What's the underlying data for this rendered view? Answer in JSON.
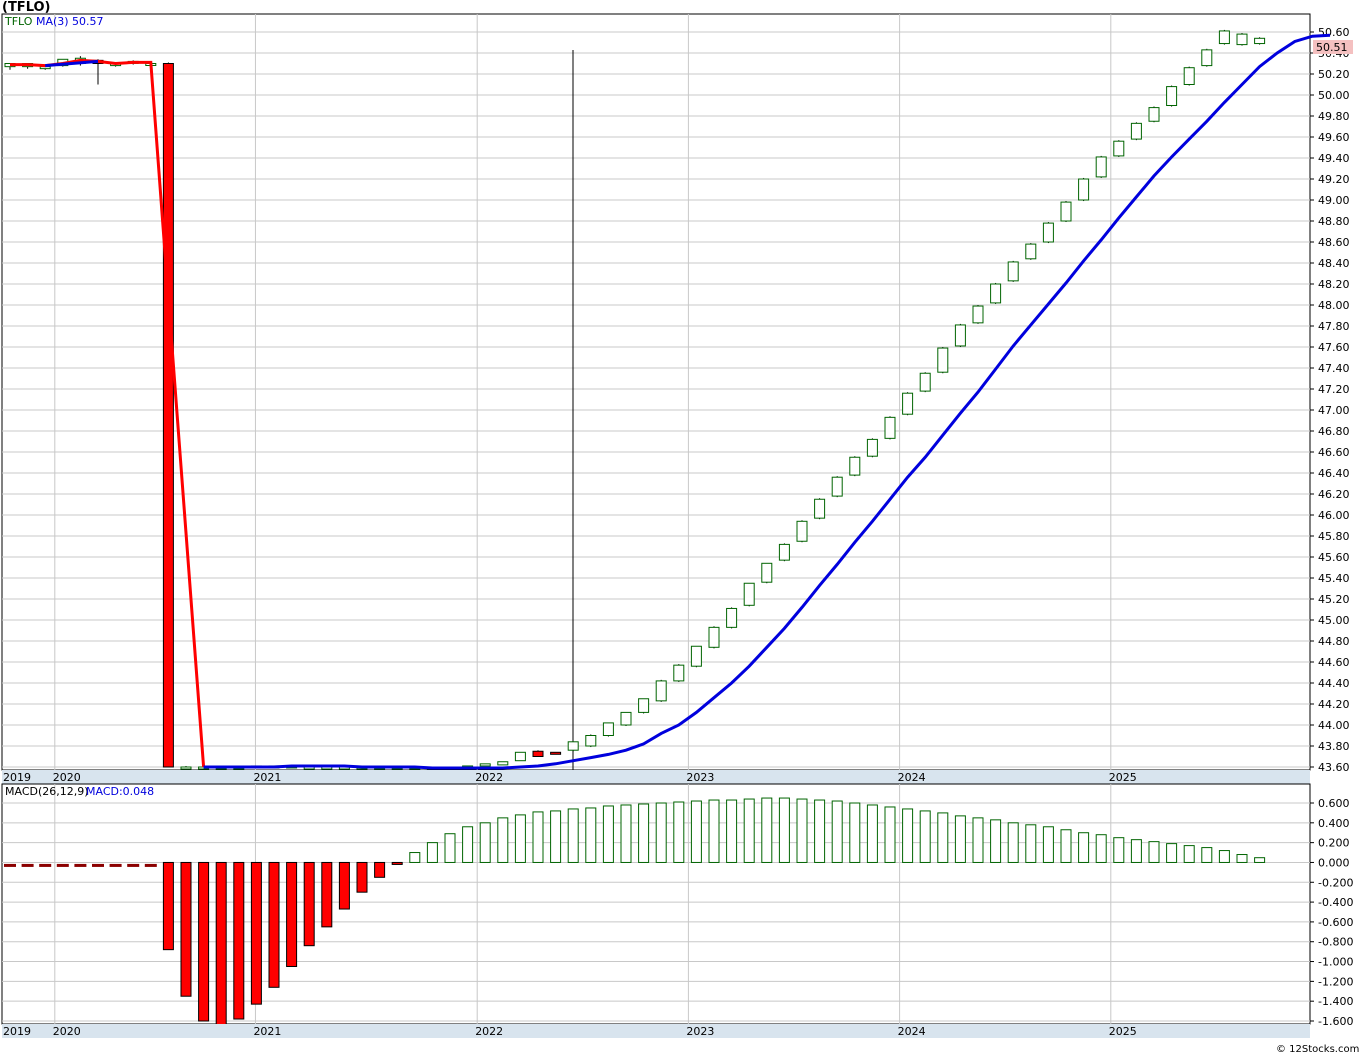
{
  "chart_title": "(TFLO)",
  "credit": "© 12Stocks.com",
  "colors": {
    "up_candle": "#006400",
    "down_candle": "#ff0000",
    "ma_line": "#0000dd",
    "pre_ma_line": "#ff0000",
    "macd_pos": "#006400",
    "macd_neg": "#ff0000",
    "macd_neg_dash": "#8b0000",
    "grid": "#c8c8c8",
    "axis_band": "#d8e4ee",
    "last_price_bg": "#f4c0c0"
  },
  "price_panel": {
    "legend": {
      "symbol": "TFLO",
      "ma_label": "MA(3)",
      "ma_value": "50.57"
    },
    "last_price": "50.51",
    "y_ticks": [
      "50.60",
      "50.40",
      "50.20",
      "50.00",
      "49.80",
      "49.60",
      "49.40",
      "49.20",
      "49.00",
      "48.80",
      "48.60",
      "48.40",
      "48.20",
      "48.00",
      "47.80",
      "47.60",
      "47.40",
      "47.20",
      "47.00",
      "46.80",
      "46.60",
      "46.40",
      "46.20",
      "46.00",
      "45.80",
      "45.60",
      "45.40",
      "45.20",
      "45.00",
      "44.80",
      "44.60",
      "44.40",
      "44.20",
      "44.00",
      "43.80",
      "43.60"
    ],
    "x_ticks": [
      "2019",
      "2020",
      "2021",
      "2022",
      "2023",
      "2024",
      "2025"
    ]
  },
  "macd_panel": {
    "legend": {
      "label": "MACD(26,12,9)",
      "value_label": "MACD:0.048"
    },
    "y_ticks": [
      "0.600",
      "0.400",
      "0.200",
      "0.000",
      "-0.200",
      "-0.400",
      "-0.600",
      "-0.800",
      "-1.000",
      "-1.200",
      "-1.400",
      "-1.600"
    ],
    "x_ticks": [
      "2019",
      "2020",
      "2021",
      "2022",
      "2023",
      "2024",
      "2025"
    ]
  },
  "chart_data": [
    {
      "type": "candlestick",
      "title": "(TFLO)",
      "ylim": [
        43.6,
        50.6
      ],
      "series": [
        {
          "name": "TFLO",
          "candles": [
            {
              "open": 50.27,
              "high": 50.3,
              "low": 50.24,
              "close": 50.3
            },
            {
              "open": 50.27,
              "high": 50.3,
              "low": 50.25,
              "close": 50.3
            },
            {
              "open": 50.26,
              "high": 50.29,
              "low": 50.24,
              "close": 50.27
            },
            {
              "open": 50.28,
              "high": 50.34,
              "low": 50.27,
              "close": 50.34
            },
            {
              "open": 50.3,
              "high": 50.37,
              "low": 50.28,
              "close": 50.35
            },
            {
              "open": 50.33,
              "high": 50.34,
              "low": 50.1,
              "close": 50.3
            },
            {
              "open": 50.28,
              "high": 50.31,
              "low": 50.27,
              "close": 50.3
            },
            {
              "open": 50.31,
              "high": 50.33,
              "low": 50.29,
              "close": 50.32
            },
            {
              "open": 50.3,
              "high": 50.32,
              "low": 50.28,
              "close": 50.3
            },
            {
              "open": 50.3,
              "high": 50.31,
              "low": 43.6,
              "close": 43.6
            },
            {
              "open": 43.6,
              "high": 43.61,
              "low": 43.59,
              "close": 43.6
            },
            {
              "open": 43.6,
              "high": 43.6,
              "low": 43.59,
              "close": 43.6
            },
            {
              "open": 43.6,
              "high": 43.6,
              "low": 43.59,
              "close": 43.6
            },
            {
              "open": 43.6,
              "high": 43.61,
              "low": 43.59,
              "close": 43.6
            },
            {
              "open": 43.6,
              "high": 43.61,
              "low": 43.6,
              "close": 43.61
            },
            {
              "open": 43.6,
              "high": 43.61,
              "low": 43.6,
              "close": 43.61
            },
            {
              "open": 43.61,
              "high": 43.62,
              "low": 43.6,
              "close": 43.61
            },
            {
              "open": 43.6,
              "high": 43.61,
              "low": 43.59,
              "close": 43.6
            },
            {
              "open": 43.6,
              "high": 43.6,
              "low": 43.59,
              "close": 43.6
            },
            {
              "open": 43.6,
              "high": 43.6,
              "low": 43.59,
              "close": 43.6
            },
            {
              "open": 43.6,
              "high": 43.61,
              "low": 43.59,
              "close": 43.6
            },
            {
              "open": 43.59,
              "high": 43.6,
              "low": 43.59,
              "close": 43.6
            },
            {
              "open": 43.59,
              "high": 43.6,
              "low": 43.59,
              "close": 43.6
            },
            {
              "open": 43.59,
              "high": 43.6,
              "low": 43.59,
              "close": 43.6
            },
            {
              "open": 43.59,
              "high": 43.6,
              "low": 43.59,
              "close": 43.6
            },
            {
              "open": 43.59,
              "high": 43.6,
              "low": 43.59,
              "close": 43.6
            },
            {
              "open": 43.6,
              "high": 43.61,
              "low": 43.6,
              "close": 43.61
            },
            {
              "open": 43.61,
              "high": 43.63,
              "low": 43.61,
              "close": 43.63
            },
            {
              "open": 43.62,
              "high": 43.65,
              "low": 43.62,
              "close": 43.65
            },
            {
              "open": 43.66,
              "high": 43.74,
              "low": 43.66,
              "close": 43.74
            },
            {
              "open": 43.75,
              "high": 43.76,
              "low": 43.7,
              "close": 43.7
            },
            {
              "open": 43.74,
              "high": 43.74,
              "low": 43.72,
              "close": 43.73
            },
            {
              "open": 43.76,
              "high": 43.84,
              "low": 43.75,
              "close": 43.84
            },
            {
              "open": 43.8,
              "high": 43.91,
              "low": 43.79,
              "close": 43.9
            },
            {
              "open": 43.9,
              "high": 44.02,
              "low": 43.89,
              "close": 44.02
            },
            {
              "open": 44.0,
              "high": 44.12,
              "low": 43.99,
              "close": 44.12
            },
            {
              "open": 44.12,
              "high": 44.25,
              "low": 44.11,
              "close": 44.25
            },
            {
              "open": 44.23,
              "high": 44.43,
              "low": 44.22,
              "close": 44.42
            },
            {
              "open": 44.42,
              "high": 44.58,
              "low": 44.41,
              "close": 44.57
            },
            {
              "open": 44.56,
              "high": 44.75,
              "low": 44.55,
              "close": 44.75
            },
            {
              "open": 44.74,
              "high": 44.94,
              "low": 44.73,
              "close": 44.93
            },
            {
              "open": 44.93,
              "high": 45.12,
              "low": 44.92,
              "close": 45.11
            },
            {
              "open": 45.14,
              "high": 45.35,
              "low": 45.13,
              "close": 45.35
            },
            {
              "open": 45.36,
              "high": 45.54,
              "low": 45.35,
              "close": 45.54
            },
            {
              "open": 45.57,
              "high": 45.73,
              "low": 45.56,
              "close": 45.72
            },
            {
              "open": 45.75,
              "high": 45.95,
              "low": 45.74,
              "close": 45.94
            },
            {
              "open": 45.97,
              "high": 46.16,
              "low": 45.96,
              "close": 46.15
            },
            {
              "open": 46.18,
              "high": 46.37,
              "low": 46.17,
              "close": 46.36
            },
            {
              "open": 46.38,
              "high": 46.56,
              "low": 46.37,
              "close": 46.55
            },
            {
              "open": 46.56,
              "high": 46.73,
              "low": 46.55,
              "close": 46.72
            },
            {
              "open": 46.73,
              "high": 46.94,
              "low": 46.72,
              "close": 46.93
            },
            {
              "open": 46.96,
              "high": 47.17,
              "low": 46.95,
              "close": 47.16
            },
            {
              "open": 47.18,
              "high": 47.36,
              "low": 47.17,
              "close": 47.35
            },
            {
              "open": 47.36,
              "high": 47.6,
              "low": 47.35,
              "close": 47.59
            },
            {
              "open": 47.61,
              "high": 47.82,
              "low": 47.6,
              "close": 47.81
            },
            {
              "open": 47.83,
              "high": 48.0,
              "low": 47.82,
              "close": 47.99
            },
            {
              "open": 48.02,
              "high": 48.21,
              "low": 48.01,
              "close": 48.2
            },
            {
              "open": 48.23,
              "high": 48.42,
              "low": 48.22,
              "close": 48.41
            },
            {
              "open": 48.44,
              "high": 48.59,
              "low": 48.43,
              "close": 48.58
            },
            {
              "open": 48.6,
              "high": 48.79,
              "low": 48.59,
              "close": 48.78
            },
            {
              "open": 48.8,
              "high": 48.99,
              "low": 48.79,
              "close": 48.98
            },
            {
              "open": 49.0,
              "high": 49.21,
              "low": 48.99,
              "close": 49.2
            },
            {
              "open": 49.22,
              "high": 49.42,
              "low": 49.21,
              "close": 49.41
            },
            {
              "open": 49.42,
              "high": 49.57,
              "low": 49.41,
              "close": 49.56
            },
            {
              "open": 49.58,
              "high": 49.74,
              "low": 49.57,
              "close": 49.73
            },
            {
              "open": 49.75,
              "high": 49.89,
              "low": 49.74,
              "close": 49.88
            },
            {
              "open": 49.9,
              "high": 50.09,
              "low": 49.89,
              "close": 50.08
            },
            {
              "open": 50.1,
              "high": 50.27,
              "low": 50.09,
              "close": 50.26
            },
            {
              "open": 50.28,
              "high": 50.44,
              "low": 50.27,
              "close": 50.43
            },
            {
              "open": 50.49,
              "high": 50.62,
              "low": 50.48,
              "close": 50.61
            },
            {
              "open": 50.48,
              "high": 50.59,
              "low": 50.47,
              "close": 50.58
            },
            {
              "open": 50.49,
              "high": 50.55,
              "low": 50.48,
              "close": 50.54
            }
          ]
        },
        {
          "name": "MA(3)",
          "pre_values": [
            50.29,
            50.29,
            50.28,
            50.3,
            50.33,
            50.32,
            50.3,
            50.31,
            50.31,
            48.06,
            45.83,
            43.6
          ],
          "values": [
            43.6,
            43.6,
            43.6,
            43.6,
            43.6,
            43.61,
            43.61,
            43.61,
            43.61,
            43.6,
            43.6,
            43.6,
            43.6,
            43.59,
            43.59,
            43.59,
            43.59,
            43.59,
            43.6,
            43.61,
            43.63,
            43.66,
            43.69,
            43.72,
            43.76,
            43.82,
            43.92,
            44.0,
            44.12,
            44.26,
            44.4,
            44.56,
            44.74,
            44.92,
            45.12,
            45.33,
            45.53,
            45.74,
            45.94,
            46.15,
            46.36,
            46.55,
            46.76,
            46.97,
            47.17,
            47.39,
            47.61,
            47.81,
            48.01,
            48.21,
            48.42,
            48.62,
            48.83,
            49.03,
            49.23,
            49.41,
            49.58,
            49.75,
            49.93,
            50.1,
            50.27,
            50.4,
            50.51,
            50.56,
            50.57
          ]
        }
      ]
    },
    {
      "type": "bar",
      "title": "MACD(26,12,9)",
      "ylim": [
        -1.6,
        0.6
      ],
      "values": [
        -0.03,
        -0.03,
        -0.03,
        -0.03,
        -0.03,
        -0.03,
        -0.03,
        -0.03,
        -0.03,
        -0.88,
        -1.35,
        -1.6,
        -1.64,
        -1.58,
        -1.43,
        -1.26,
        -1.05,
        -0.84,
        -0.65,
        -0.47,
        -0.3,
        -0.15,
        -0.02,
        0.1,
        0.2,
        0.29,
        0.36,
        0.4,
        0.45,
        0.48,
        0.51,
        0.52,
        0.54,
        0.55,
        0.57,
        0.58,
        0.59,
        0.6,
        0.61,
        0.62,
        0.63,
        0.63,
        0.64,
        0.65,
        0.65,
        0.64,
        0.63,
        0.62,
        0.6,
        0.58,
        0.56,
        0.54,
        0.52,
        0.5,
        0.47,
        0.45,
        0.43,
        0.4,
        0.38,
        0.36,
        0.33,
        0.3,
        0.28,
        0.25,
        0.23,
        0.21,
        0.19,
        0.17,
        0.15,
        0.12,
        0.08,
        0.048
      ]
    }
  ]
}
